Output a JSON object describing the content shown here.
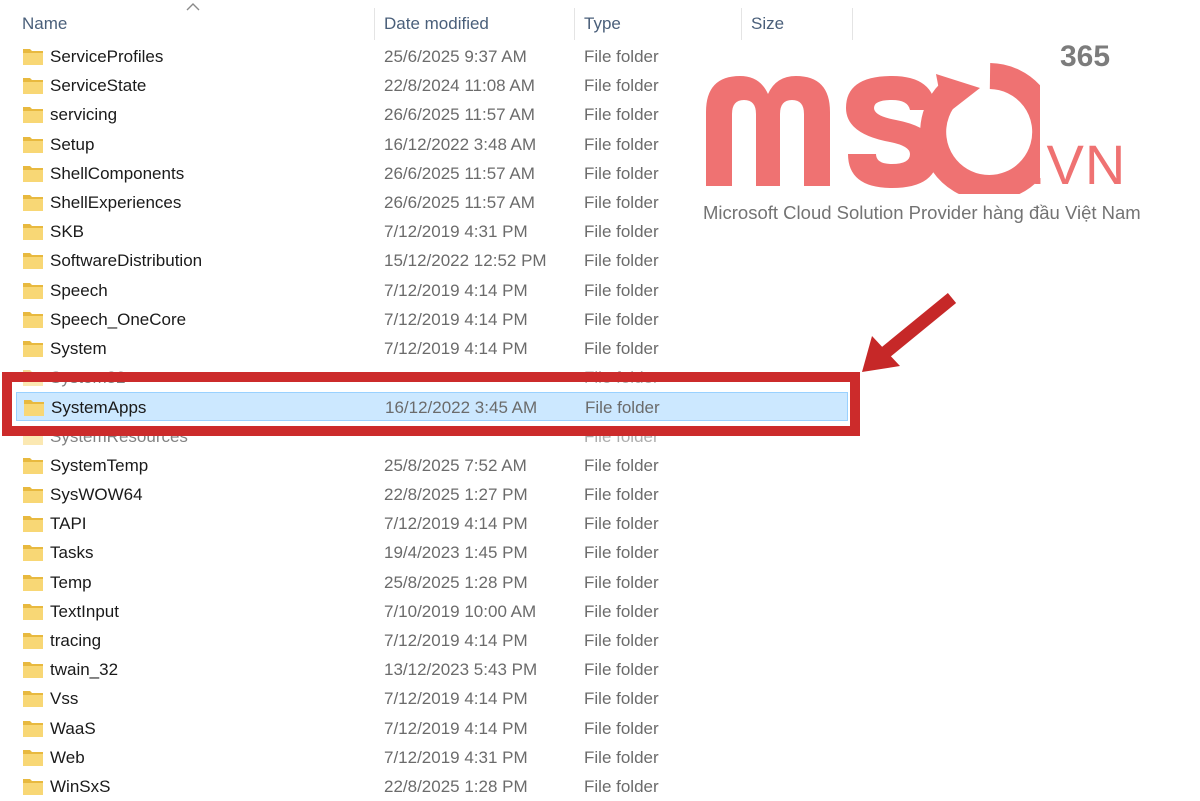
{
  "columns": {
    "name": "Name",
    "date_modified": "Date modified",
    "type": "Type",
    "size": "Size"
  },
  "sort": {
    "column": "name",
    "direction": "ascending"
  },
  "rows": [
    {
      "name": "ServiceProfiles",
      "date": "25/6/2025 9:37 AM",
      "type": "File folder"
    },
    {
      "name": "ServiceState",
      "date": "22/8/2024 11:08 AM",
      "type": "File folder"
    },
    {
      "name": "servicing",
      "date": "26/6/2025 11:57 AM",
      "type": "File folder"
    },
    {
      "name": "Setup",
      "date": "16/12/2022 3:48 AM",
      "type": "File folder"
    },
    {
      "name": "ShellComponents",
      "date": "26/6/2025 11:57 AM",
      "type": "File folder"
    },
    {
      "name": "ShellExperiences",
      "date": "26/6/2025 11:57 AM",
      "type": "File folder"
    },
    {
      "name": "SKB",
      "date": "7/12/2019 4:31 PM",
      "type": "File folder"
    },
    {
      "name": "SoftwareDistribution",
      "date": "15/12/2022 12:52 PM",
      "type": "File folder"
    },
    {
      "name": "Speech",
      "date": "7/12/2019 4:14 PM",
      "type": "File folder"
    },
    {
      "name": "Speech_OneCore",
      "date": "7/12/2019 4:14 PM",
      "type": "File folder"
    },
    {
      "name": "System",
      "date": "7/12/2019 4:14 PM",
      "type": "File folder"
    },
    {
      "name": "System32",
      "date": "",
      "type": "File folder"
    },
    {
      "name": "SystemApps",
      "date": "16/12/2022 3:45 AM",
      "type": "File folder"
    },
    {
      "name": "SystemResources",
      "date": "",
      "type": "File folder"
    },
    {
      "name": "SystemTemp",
      "date": "25/8/2025 7:52 AM",
      "type": "File folder"
    },
    {
      "name": "SysWOW64",
      "date": "22/8/2025 1:27 PM",
      "type": "File folder"
    },
    {
      "name": "TAPI",
      "date": "7/12/2019 4:14 PM",
      "type": "File folder"
    },
    {
      "name": "Tasks",
      "date": "19/4/2023 1:45 PM",
      "type": "File folder"
    },
    {
      "name": "Temp",
      "date": "25/8/2025 1:28 PM",
      "type": "File folder"
    },
    {
      "name": "TextInput",
      "date": "7/10/2019 10:00 AM",
      "type": "File folder"
    },
    {
      "name": "tracing",
      "date": "7/12/2019 4:14 PM",
      "type": "File folder"
    },
    {
      "name": "twain_32",
      "date": "13/12/2023 5:43 PM",
      "type": "File folder"
    },
    {
      "name": "Vss",
      "date": "7/12/2019 4:14 PM",
      "type": "File folder"
    },
    {
      "name": "WaaS",
      "date": "7/12/2019 4:14 PM",
      "type": "File folder"
    },
    {
      "name": "Web",
      "date": "7/12/2019 4:31 PM",
      "type": "File folder"
    },
    {
      "name": "WinSxS",
      "date": "22/8/2025 1:28 PM",
      "type": "File folder"
    }
  ],
  "selected_row": "SystemApps",
  "icons": {
    "folder": "folder-icon",
    "sort": "sort-ascending-icon",
    "annotation": "arrow-pointer"
  },
  "colors": {
    "selection_bg": "#cce8ff",
    "selection_border": "#99d1ff",
    "highlight": "#cc2b2b",
    "logo_pink": "#ef7272",
    "logo_gray": "#7c7c7c",
    "folder": "#f8d775"
  },
  "watermark": {
    "brand": "MSO",
    "badge": "365",
    "suffix": ".VN",
    "tagline": "Microsoft Cloud Solution Provider hàng đầu Việt Nam"
  }
}
